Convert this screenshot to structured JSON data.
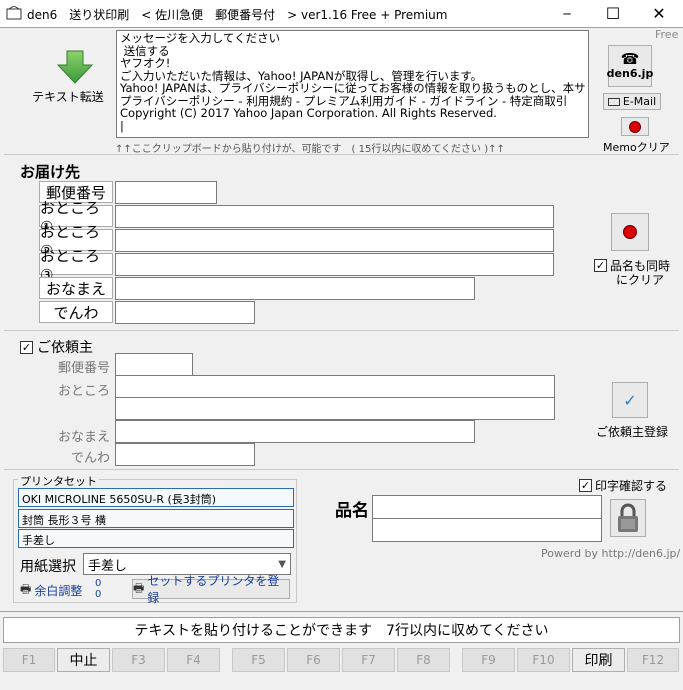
{
  "window": {
    "title": "den6　送り状印刷　< 佐川急便　郵便番号付　> ver1.16 Free + Premium",
    "minimize": "─",
    "maximize": "☐",
    "close": "✕"
  },
  "free_label": "Free",
  "toolbar": {
    "paste_button_label": "テキスト転送",
    "den6_label": "den6.jp",
    "email_label": "E-Mail",
    "memo_clear_label": "Memoクリア"
  },
  "memo": {
    "text": "メッセージを入力してください\n 送信する\nヤフオク!\nご入力いただいた情報は、Yahoo! JAPANが取得し、管理を行います。\nYahoo! JAPANは、プライバシーポリシーに従ってお客様の情報を取り扱うものとし、本サ\nプライバシーポリシー - 利用規約 - プレミアム利用ガイド - ガイドライン - 特定商取引\nCopyright (C) 2017 Yahoo Japan Corporation. All Rights Reserved.\n|",
    "hint": "↑↑ここクリップボードから貼り付けが、可能です　( 15行以内に収めてください )↑↑"
  },
  "recipient": {
    "title": "お届け先",
    "labels": {
      "postal": "郵便番号",
      "address1": "おところ①",
      "address2": "おところ②",
      "address3": "おところ③",
      "name": "おなまえ",
      "phone": "でんわ"
    },
    "clear_with_item": "品名も同時\nにクリア"
  },
  "sender": {
    "title": "ご依頼主",
    "labels": {
      "postal": "郵便番号",
      "address": "おところ",
      "name": "おなまえ",
      "phone": "でんわ"
    },
    "register_label": "ご依頼主登録"
  },
  "printer": {
    "legend": "プリンタセット",
    "printer_name": "OKI MICROLINE 5650SU-R (長3封筒)",
    "paper": "封筒 長形３号 横",
    "feed": "手差し",
    "paper_select_label": "用紙選択",
    "paper_select_value": "手差し",
    "margin_button": "余白調整",
    "margin_values": [
      "0",
      "0"
    ],
    "register_printer_button": "セットするプリンタを登録"
  },
  "item": {
    "label": "品名",
    "print_confirm": "印字確認する",
    "powered_by": "Powerd by http://den6.jp/"
  },
  "status": "テキストを貼り付けることができます　7行以内に収めてください",
  "function_keys": [
    {
      "label": "F1",
      "enabled": false
    },
    {
      "label": "中止",
      "enabled": true
    },
    {
      "label": "F3",
      "enabled": false
    },
    {
      "label": "F4",
      "enabled": false
    },
    {
      "label": "F5",
      "enabled": false
    },
    {
      "label": "F6",
      "enabled": false
    },
    {
      "label": "F7",
      "enabled": false
    },
    {
      "label": "F8",
      "enabled": false
    },
    {
      "label": "F9",
      "enabled": false
    },
    {
      "label": "F10",
      "enabled": false
    },
    {
      "label": "印刷",
      "enabled": true
    },
    {
      "label": "F12",
      "enabled": false
    }
  ],
  "colors": {
    "accent_green": "#5cb85c",
    "field_border_blue": "#2b6bb5",
    "clear_red": "#c00000"
  }
}
